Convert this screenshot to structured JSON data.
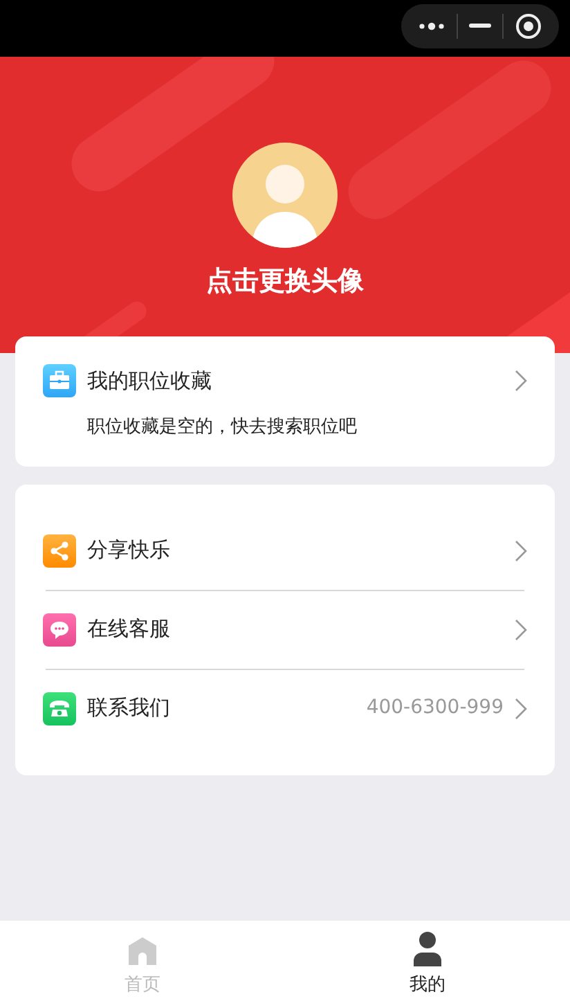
{
  "header": {
    "avatar_caption": "点击更换头像"
  },
  "favorites": {
    "title": "我的职位收藏",
    "empty_text": "职位收藏是空的，快去搜索职位吧"
  },
  "menu": [
    {
      "kind": "share",
      "label": "分享快乐"
    },
    {
      "kind": "chat",
      "label": "在线客服"
    },
    {
      "kind": "phone",
      "label": "联系我们",
      "value": "400-6300-999"
    }
  ],
  "tabbar": [
    {
      "kind": "home",
      "label": "首页",
      "selected": false
    },
    {
      "kind": "profile",
      "label": "我的",
      "selected": true
    }
  ]
}
